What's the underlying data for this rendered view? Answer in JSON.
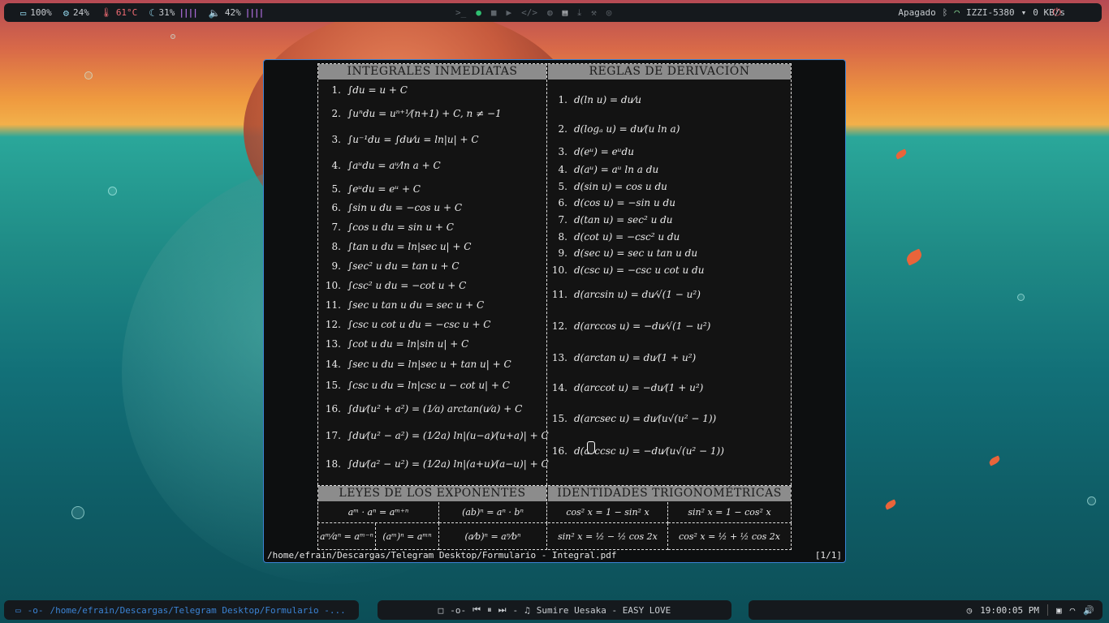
{
  "topbar": {
    "battery_label": "100%",
    "cpu_label": "24%",
    "temp_label": "61°C",
    "memory_label": "31%",
    "memory_bars": "||||",
    "volume_label": "42%",
    "volume_bars": "||||",
    "bluetooth_status": "Apagado",
    "wifi_ssid": "IZZI-5380",
    "net_speed": "0 KB/s"
  },
  "viewer": {
    "integrals_title": "INTEGRALES INMEDIATAS",
    "derivation_title": "REGLAS DE DERIVACIÓN",
    "exponents_title": "LEYES DE LOS EXPONENTES",
    "trig_title": "IDENTIDADES TRIGONOMÉTRICAS",
    "integrals": [
      {
        "n": "1.",
        "f": "∫du = u + C"
      },
      {
        "n": "2.",
        "f": "∫uⁿdu = uⁿ⁺¹⁄(n+1) + C, n ≠ −1"
      },
      {
        "n": "3.",
        "f": "∫u⁻¹du = ∫du⁄u = ln|u| + C"
      },
      {
        "n": "4.",
        "f": "∫aᵘdu = aᵘ⁄ln a + C"
      },
      {
        "n": "5.",
        "f": "∫eᵘdu = eᵘ + C"
      },
      {
        "n": "6.",
        "f": "∫sin u du = −cos u + C"
      },
      {
        "n": "7.",
        "f": "∫cos u du = sin u + C"
      },
      {
        "n": "8.",
        "f": "∫tan u du = ln|sec u| + C"
      },
      {
        "n": "9.",
        "f": "∫sec² u du = tan u + C"
      },
      {
        "n": "10.",
        "f": "∫csc² u du = −cot u + C"
      },
      {
        "n": "11.",
        "f": "∫sec u tan u du = sec u + C"
      },
      {
        "n": "12.",
        "f": "∫csc u cot u du = −csc u + C"
      },
      {
        "n": "13.",
        "f": "∫cot u du = ln|sin u| + C"
      },
      {
        "n": "14.",
        "f": "∫sec u du = ln|sec u + tan u| + C"
      },
      {
        "n": "15.",
        "f": "∫csc u du = ln|csc u − cot u| + C"
      },
      {
        "n": "16.",
        "f": "∫du⁄(u² + a²) = (1⁄a) arctan(u⁄a) + C"
      },
      {
        "n": "17.",
        "f": "∫du⁄(u² − a²) = (1⁄2a) ln|(u−a)⁄(u+a)| + C"
      },
      {
        "n": "18.",
        "f": "∫du⁄(a² − u²) = (1⁄2a) ln|(a+u)⁄(a−u)| + C"
      }
    ],
    "derivatives": [
      {
        "n": "1.",
        "f": "d(ln u) = du⁄u"
      },
      {
        "n": "2.",
        "f": "d(logₐ u) = du⁄(u ln a)"
      },
      {
        "n": "3.",
        "f": "d(eᵘ) = eᵘdu"
      },
      {
        "n": "4.",
        "f": "d(aᵘ) = aᵘ ln a du"
      },
      {
        "n": "5.",
        "f": "d(sin u) = cos u du"
      },
      {
        "n": "6.",
        "f": "d(cos u) = −sin u du"
      },
      {
        "n": "7.",
        "f": "d(tan u) = sec² u du"
      },
      {
        "n": "8.",
        "f": "d(cot u) = −csc² u du"
      },
      {
        "n": "9.",
        "f": "d(sec u) = sec u tan u du"
      },
      {
        "n": "10.",
        "f": "d(csc u) = −csc u cot u du"
      },
      {
        "n": "11.",
        "f": "d(arcsin u) = du⁄√(1 − u²)"
      },
      {
        "n": "12.",
        "f": "d(arccos u) = −du⁄√(1 − u²)"
      },
      {
        "n": "13.",
        "f": "d(arctan u) = du⁄(1 + u²)"
      },
      {
        "n": "14.",
        "f": "d(arccot u) = −du⁄(1 + u²)"
      },
      {
        "n": "15.",
        "f": "d(arcsec u) = du⁄(u√(u² − 1))"
      },
      {
        "n": "16.",
        "f": "d(arccsc u) = −du⁄(u√(u² − 1))"
      }
    ],
    "exponents": [
      "aᵐ · aⁿ = aᵐ⁺ⁿ",
      "(ab)ⁿ = aⁿ · bⁿ",
      "aᵐ⁄aⁿ = aᵐ⁻ⁿ",
      "(aᵐ)ⁿ = aᵐⁿ",
      "(a⁄b)ⁿ = aⁿ⁄bⁿ"
    ],
    "trig": [
      "cos² x = 1 − sin² x",
      "sin² x = 1 − cos² x",
      "sin² x = ½ − ½ cos 2x",
      "cos² x = ½ + ½ cos 2x"
    ],
    "file_path": "/home/efrain/Descargas/Telegram Desktop/Formulario - Integral.pdf",
    "page_indicator": "[1/1]"
  },
  "bottombar": {
    "window_path": "/home/efrain/Descargas/Telegram Desktop/Formulario -...",
    "track": "Sumire Uesaka - EASY LOVE",
    "clock": "19:00:05 PM"
  }
}
